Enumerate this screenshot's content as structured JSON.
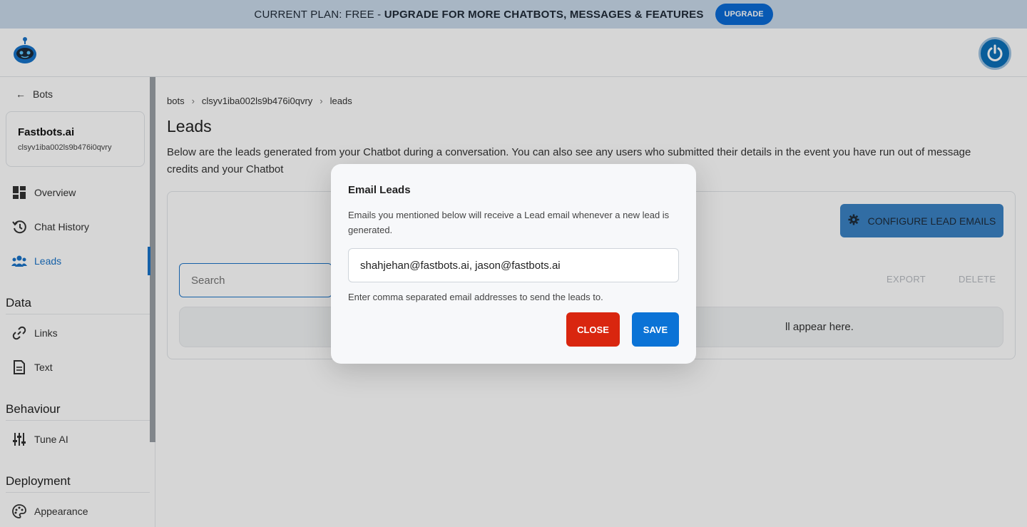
{
  "banner": {
    "prefix": "CURRENT PLAN: FREE - ",
    "highlight": "UPGRADE FOR MORE CHATBOTS, MESSAGES & FEATURES",
    "button_label": "UPGRADE"
  },
  "sidebar": {
    "back_label": "Bots",
    "bot_name": "Fastbots.ai",
    "bot_id": "clsyv1iba002ls9b476i0qvry",
    "items": [
      {
        "label": "Overview",
        "icon": "dashboard-icon"
      },
      {
        "label": "Chat History",
        "icon": "history-icon"
      },
      {
        "label": "Leads",
        "icon": "people-icon",
        "active": true
      }
    ],
    "sections": {
      "data": {
        "title": "Data",
        "items": [
          {
            "label": "Links",
            "icon": "link-icon"
          },
          {
            "label": "Text",
            "icon": "document-icon"
          }
        ]
      },
      "behaviour": {
        "title": "Behaviour",
        "items": [
          {
            "label": "Tune AI",
            "icon": "sliders-icon"
          }
        ]
      },
      "deployment": {
        "title": "Deployment",
        "items": [
          {
            "label": "Appearance",
            "icon": "palette-icon"
          }
        ]
      }
    }
  },
  "main": {
    "breadcrumb": [
      "bots",
      "clsyv1iba002ls9b476i0qvry",
      "leads"
    ],
    "title": "Leads",
    "description": "Below are the leads generated from your Chatbot during a conversation. You can also see any users who submitted their details in the event you have run out of message credits and your Chatbot",
    "configure_label": "CONFIGURE LEAD EMAILS",
    "search_placeholder": "Search",
    "export_label": "EXPORT",
    "delete_label": "DELETE",
    "empty_text": "ll appear here."
  },
  "modal": {
    "title": "Email Leads",
    "description": "Emails you mentioned below will receive a Lead email whenever a new lead is generated.",
    "input_value": "shahjehan@fastbots.ai, jason@fastbots.ai",
    "help_text": "Enter comma separated email addresses to send the leads to.",
    "close_label": "CLOSE",
    "save_label": "SAVE"
  },
  "colors": {
    "accent": "#1a73c8",
    "banner_bg": "#c9d9ea",
    "close_red": "#d9260f",
    "save_blue": "#0b73d6"
  }
}
